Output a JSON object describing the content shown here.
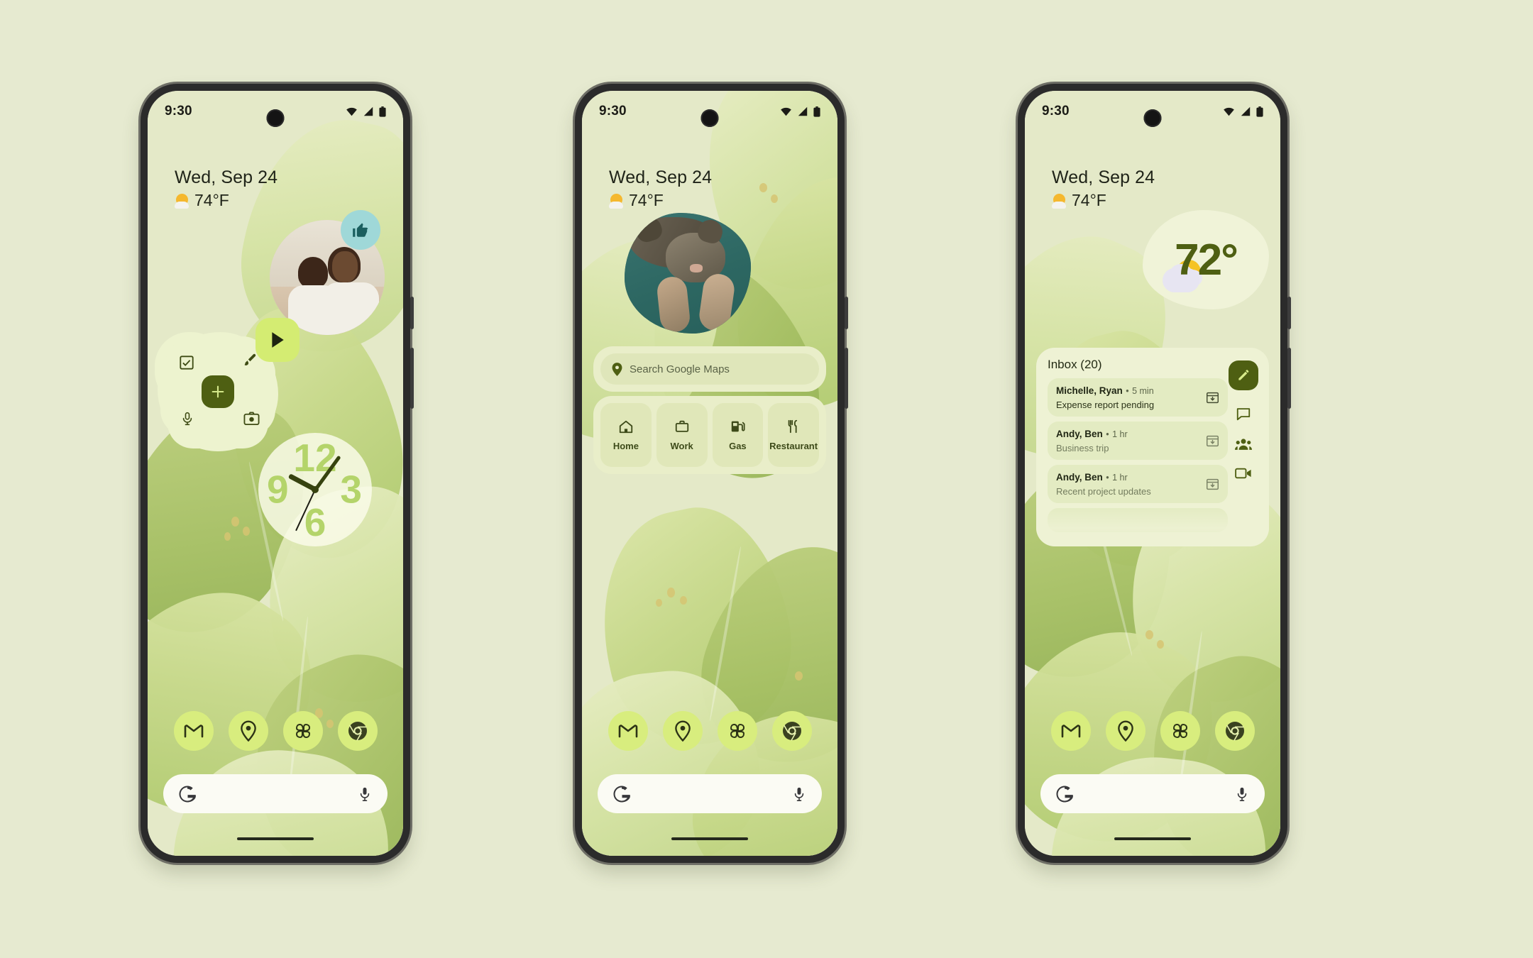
{
  "page": {
    "background_color": "#e6ead0",
    "accent_green": "#4e5f12",
    "chip_green": "#d8ed7e",
    "widget_surface": "#eef2d4"
  },
  "status_bar": {
    "time": "9:30",
    "icons": [
      "wifi-icon",
      "cell-signal-icon",
      "battery-icon"
    ]
  },
  "at_a_glance": {
    "date": "Wed, Sep 24",
    "temperature": "74°F",
    "weather_icon": "sun-behind-cloud-icon"
  },
  "dock": {
    "items": [
      {
        "name": "gmail",
        "label": "Gmail",
        "icon": "gmail-m-icon"
      },
      {
        "name": "maps",
        "label": "Maps",
        "icon": "map-pin-icon"
      },
      {
        "name": "photos",
        "label": "Photos",
        "icon": "photos-pinwheel-icon"
      },
      {
        "name": "chrome",
        "label": "Chrome",
        "icon": "chrome-icon"
      }
    ]
  },
  "search_bar": {
    "leading_icon": "google-g-icon",
    "trailing_icon": "microphone-icon",
    "placeholder": ""
  },
  "phone1": {
    "photo_widget": {
      "name": "photo-memory-widget",
      "thumbs_up_badge": "thumbs-up-icon",
      "play_badge": "play-triangle-icon"
    },
    "keep_widget": {
      "name": "google-keep-widget",
      "actions": [
        {
          "name": "new-checklist",
          "icon": "checkbox-icon"
        },
        {
          "name": "new-drawing",
          "icon": "paintbrush-icon"
        },
        {
          "name": "new-note",
          "icon": "plus-icon"
        },
        {
          "name": "new-voice-note",
          "icon": "microphone-icon"
        },
        {
          "name": "new-image-note",
          "icon": "camera-icon"
        }
      ]
    },
    "clock_widget": {
      "name": "analog-clock-widget",
      "numerals": [
        "12",
        "3",
        "6",
        "9"
      ],
      "hour_angle_deg": -62,
      "minute_angle_deg": 36,
      "second_angle_deg": 205
    }
  },
  "phone2": {
    "photo_widget": {
      "name": "cat-photo-widget"
    },
    "maps_widget": {
      "name": "google-maps-widget",
      "search_placeholder": "Search Google Maps",
      "search_icon": "map-pin-icon",
      "shortcuts": [
        {
          "label": "Home",
          "icon": "home-icon"
        },
        {
          "label": "Work",
          "icon": "briefcase-icon"
        },
        {
          "label": "Gas",
          "icon": "gas-pump-icon"
        },
        {
          "label": "Restaurant",
          "icon": "fork-knife-icon"
        }
      ]
    }
  },
  "phone3": {
    "weather_widget": {
      "name": "weather-widget",
      "temperature": "72°",
      "condition_icon": "sun-behind-cloud-icon"
    },
    "gmail_widget": {
      "name": "gmail-inbox-widget",
      "title": "Inbox (20)",
      "compose_icon": "pencil-compose-icon",
      "rail_icons": [
        {
          "name": "chat-bubble-icon"
        },
        {
          "name": "people-group-icon"
        },
        {
          "name": "video-camera-icon"
        }
      ],
      "rows": [
        {
          "sender": "Michelle, Ryan",
          "separator": "•",
          "time": "5 min",
          "subject": "Expense report pending",
          "action_icon": "archive-icon",
          "unread": true
        },
        {
          "sender": "Andy, Ben",
          "separator": "•",
          "time": "1 hr",
          "subject": "Business trip",
          "action_icon": "archive-icon",
          "unread": false
        },
        {
          "sender": "Andy, Ben",
          "separator": "•",
          "time": "1 hr",
          "subject": "Recent project updates",
          "action_icon": "archive-icon",
          "unread": false
        }
      ]
    }
  }
}
